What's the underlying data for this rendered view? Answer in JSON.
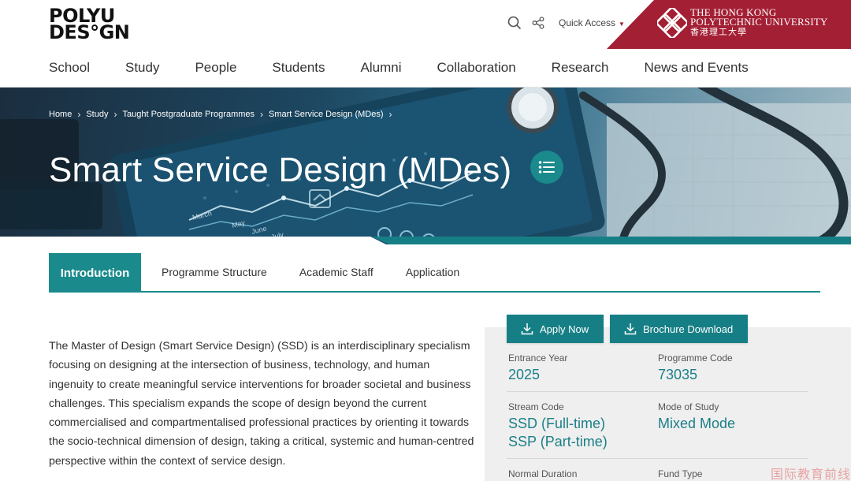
{
  "header": {
    "logo_line1": "POLYU",
    "logo_line2": "DES°GN",
    "search_icon": "search-icon",
    "share_icon": "share-icon",
    "quick_access": "Quick Access",
    "university_en_line1": "THE HONG KONG",
    "university_en_line2": "POLYTECHNIC UNIVERSITY",
    "university_zh": "香港理工大學"
  },
  "nav": {
    "items": [
      "School",
      "Study",
      "People",
      "Students",
      "Alumni",
      "Collaboration",
      "Research",
      "News and Events"
    ]
  },
  "breadcrumb": {
    "items": [
      "Home",
      "Study",
      "Taught Postgraduate Programmes",
      "Smart Service Design (MDes)"
    ]
  },
  "hero": {
    "title": "Smart Service Design (MDes)",
    "list_icon": "list-icon",
    "chart_labels": [
      "March",
      "May",
      "June",
      "July"
    ]
  },
  "tabs": {
    "items": [
      "Introduction",
      "Programme Structure",
      "Academic Staff",
      "Application"
    ],
    "active": "Introduction"
  },
  "intro": {
    "text": "The Master of Design (Smart Service Design) (SSD) is an interdisciplinary specialism focusing on designing at the intersection of business, technology, and human ingenuity to create meaningful service interventions for broader societal and business challenges. This specialism expands the scope of design beyond the current commercialised and compartmentalised professional practices by orienting it towards the socio-technical dimension of design, taking a critical, systemic and human-centred perspective within the context of service design."
  },
  "actions": {
    "apply_label": "Apply Now",
    "brochure_label": "Brochure Download"
  },
  "programme_info": {
    "entrance_year_label": "Entrance Year",
    "entrance_year": "2025",
    "programme_code_label": "Programme Code",
    "programme_code": "73035",
    "stream_code_label": "Stream Code",
    "stream_code_1": "SSD (Full-time)",
    "stream_code_2": "SSP (Part-time)",
    "mode_label": "Mode of Study",
    "mode": "Mixed Mode",
    "duration_label": "Normal Duration",
    "fund_label": "Fund Type"
  },
  "watermark": "国际教育前线",
  "colors": {
    "teal": "#1a8a8c",
    "brand_red": "#a31f34"
  }
}
